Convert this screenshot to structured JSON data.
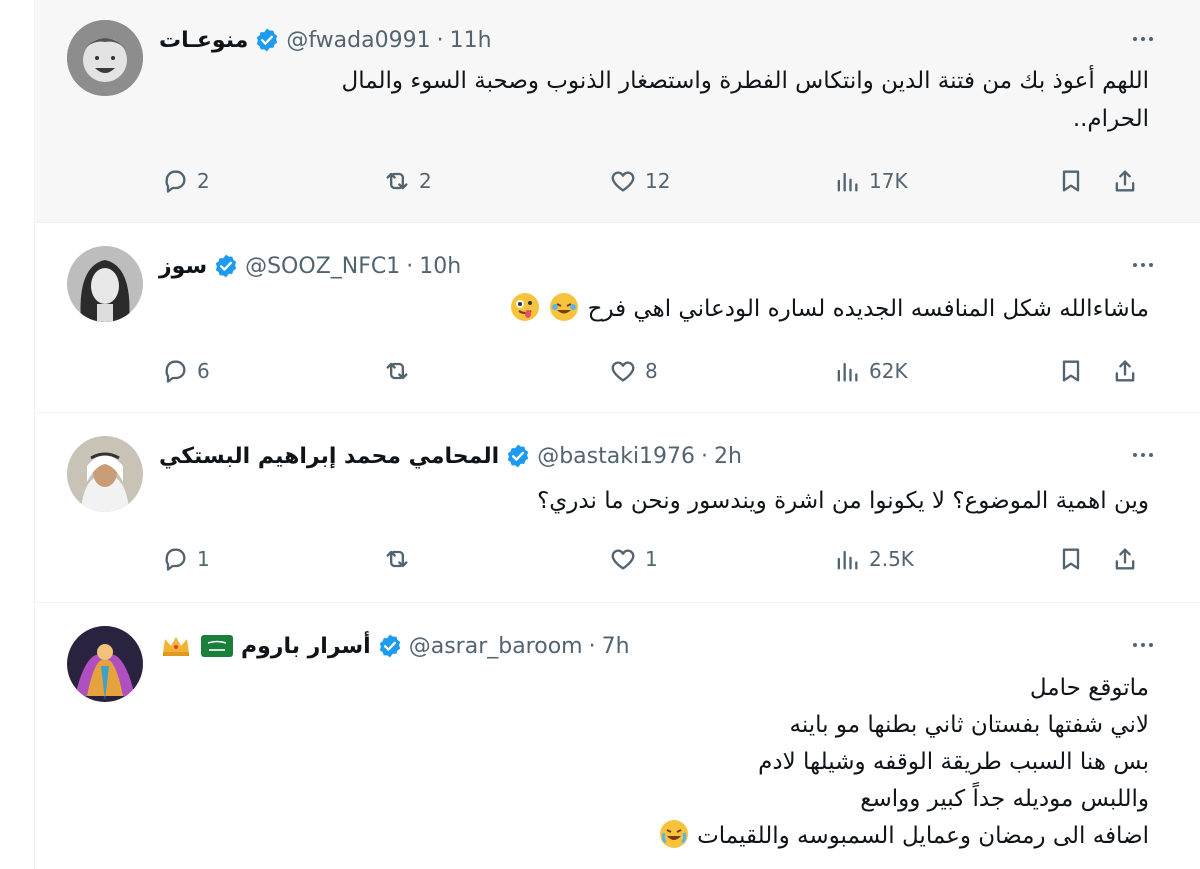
{
  "tweets": [
    {
      "name": "منوعـات",
      "handle": "@fwada0991",
      "sep": "·",
      "time": "11h",
      "lines": [
        "اللهم أعوذ بك من فتنة الدين وانتكاس الفطرة واستصغار الذنوب وصحبة السوء والمال",
        "الحرام.."
      ],
      "stats": {
        "replies": "2",
        "retweets": "2",
        "likes": "12",
        "views": "17K"
      }
    },
    {
      "name": "سوز",
      "handle": "@SOOZ_NFC1",
      "sep": "·",
      "time": "10h",
      "lines": [
        "ماشاءالله شكل المنافسه الجديده لساره الودعاني اهي فرح"
      ],
      "stats": {
        "replies": "6",
        "retweets": "",
        "likes": "8",
        "views": "62K"
      }
    },
    {
      "name": "المحامي محمد إبراهيم البستكي",
      "handle": "@bastaki1976",
      "sep": "·",
      "time": "2h",
      "lines": [
        "وين اهمية الموضوع؟ لا يكونوا من اشرة ويندسور ونحن ما ندري؟"
      ],
      "stats": {
        "replies": "1",
        "retweets": "",
        "likes": "1",
        "views": "2.5K"
      }
    },
    {
      "name": "أسرار باروم",
      "handle": "@asrar_baroom",
      "sep": "·",
      "time": "7h",
      "lines": [
        "ماتوقع حامل",
        "لاني شفتها بفستان ثاني بطنها مو باينه",
        "بس هنا السبب طريقة الوقفه وشيلها لادم",
        "واللبس موديله جداً كبير وواسع",
        "اضافه الى رمضان وعمايل السمبوسه واللقيمات"
      ]
    }
  ],
  "colors": {
    "accent": "#1d9bf0",
    "muted": "#536471",
    "text": "#0f1419",
    "hover_bg": "#f7f7f7"
  },
  "icons": [
    "verified-badge-icon",
    "reply-icon",
    "retweet-icon",
    "like-icon",
    "views-icon",
    "bookmark-icon",
    "share-icon",
    "more-icon",
    "laughing-emoji",
    "crying-laughing-emoji",
    "zany-face-emoji",
    "crown-emoji",
    "saudi-flag-emoji"
  ]
}
